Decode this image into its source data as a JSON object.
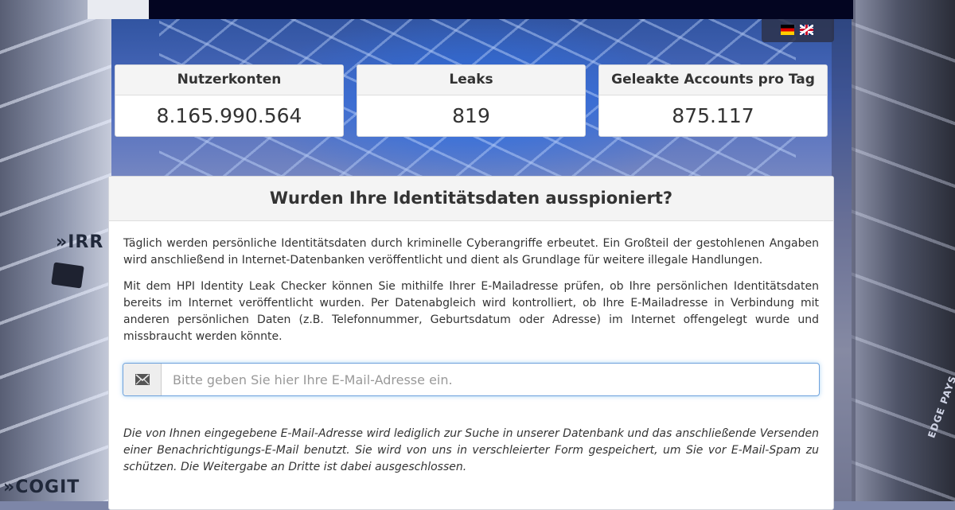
{
  "languages": [
    {
      "code": "de",
      "icon": "flag-germany-icon"
    },
    {
      "code": "en",
      "icon": "flag-uk-icon"
    }
  ],
  "stats": [
    {
      "label": "Nutzerkonten",
      "value": "8.165.990.564"
    },
    {
      "label": "Leaks",
      "value": "819"
    },
    {
      "label": "Geleakte Accounts pro Tag",
      "value": "875.117"
    }
  ],
  "main": {
    "title": "Wurden Ihre Identitätsdaten ausspioniert?",
    "paragraph1": "Täglich werden persönliche Identitätsdaten durch kriminelle Cyberangriffe erbeutet. Ein Großteil der gestohlenen Angaben wird anschließend in Internet-Datenbanken veröffentlicht und dient als Grundlage für weitere illegale Handlungen.",
    "paragraph2": "Mit dem HPI Identity Leak Checker können Sie mithilfe Ihrer E-Mailadresse prüfen, ob Ihre persönlichen Identitätsdaten bereits im Internet veröffentlicht wurden. Per Datenabgleich wird kontrolliert, ob Ihre E-Mailadresse in Verbindung mit anderen persönlichen Daten (z.B. Telefonnummer, Geburtsdatum oder Adresse) im Internet offengelegt wurde und missbraucht werden könnte.",
    "email": {
      "icon": "envelope-icon",
      "value": "",
      "placeholder": "Bitte geben Sie hier Ihre E-Mail-Adresse ein."
    },
    "privacy_note": "Die von Ihnen eingegebene E-Mail-Adresse wird lediglich zur Suche in unserer Datenbank und das anschließende Versenden einer Benachrichtigungs-E-Mail benutzt. Sie wird von uns in verschleierter Form gespeichert, um Sie vor E-Mail-Spam zu schützen. Die Weitergabe an Dritte ist dabei ausgeschlossen."
  },
  "background_text": {
    "top": "»IRR",
    "bottom": "»COGIT",
    "right": "EDGE PAYS"
  },
  "colors": {
    "topbar": "#030521",
    "focus_border": "#6fa2dc"
  }
}
